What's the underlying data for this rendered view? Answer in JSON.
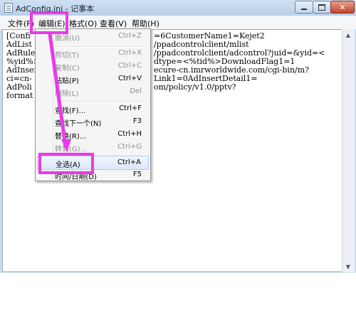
{
  "window": {
    "title": "AdConfig.ini - 记事本",
    "controls": {
      "minimize": "minimize",
      "maximize": "maximize",
      "close": "✕"
    }
  },
  "menubar": {
    "items": [
      "文件(F)",
      "编辑(E)",
      "格式(O)",
      "查看(V)",
      "帮助(H)"
    ]
  },
  "editor": {
    "lines": [
      "[Confi",
      "AdList",
      "AdRule",
      "%yid%>",
      "AdInser",
      "ci=cn-",
      "AdPoli",
      "format"
    ],
    "right_fragments": [
      "=6CustomerName1=Kejet2",
      "/ppadcontrolclient/mlist",
      "/ppadcontrolclient/adcontrol?juid=&yid=<",
      "dtype=<%tid%>DownloadFlag1=1",
      "ecure-cn.imrworldwide.com/cgi-bin/m?",
      "Link1=0AdInsertDetail1=",
      "om/policy/v1.0/pptv?",
      ""
    ]
  },
  "edit_menu": {
    "items": [
      {
        "label": "撤消(U)",
        "shortcut": "Ctrl+Z",
        "enabled": false
      },
      {
        "label": "剪切(T)",
        "shortcut": "Ctrl+X",
        "enabled": false
      },
      {
        "label": "复制(C)",
        "shortcut": "Ctrl+C",
        "enabled": false
      },
      {
        "label": "粘贴(P)",
        "shortcut": "Ctrl+V",
        "enabled": true
      },
      {
        "label": "删除(L)",
        "shortcut": "Del",
        "enabled": false
      },
      {
        "label": "查找(F)...",
        "shortcut": "Ctrl+F",
        "enabled": true
      },
      {
        "label": "查找下一个(N)",
        "shortcut": "F3",
        "enabled": true
      },
      {
        "label": "替换(R)...",
        "shortcut": "Ctrl+H",
        "enabled": true
      },
      {
        "label": "转到(G)...",
        "shortcut": "Ctrl+G",
        "enabled": false
      },
      {
        "label": "全选(A)",
        "shortcut": "Ctrl+A",
        "enabled": true,
        "highlighted": true
      },
      {
        "label": "时间/日期(D)",
        "shortcut": "F5",
        "enabled": true
      }
    ]
  },
  "colors": {
    "annotation": "#e83ae8",
    "title_bar": "#c9dcef",
    "menu_hover": "#dbe8f8"
  },
  "icons": {
    "app": "notepad-icon",
    "scroll_up": "▲",
    "scroll_down": "▼"
  }
}
